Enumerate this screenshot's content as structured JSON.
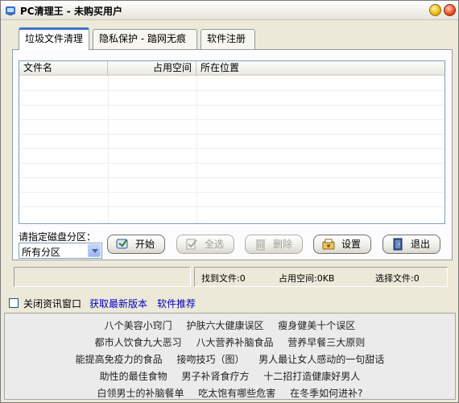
{
  "window": {
    "title": "PC清理王 - 未购买用户"
  },
  "tabs": [
    {
      "label": "垃圾文件清理"
    },
    {
      "label": "隐私保护 - 踏网无痕"
    },
    {
      "label": "软件注册"
    }
  ],
  "table": {
    "columns": [
      "文件名",
      "占用空间",
      "所在位置"
    ],
    "rows": []
  },
  "disk": {
    "label": "请指定磁盘分区：",
    "selected": "所有分区"
  },
  "buttons": {
    "start": "开始",
    "select_all": "全选",
    "delete": "删除",
    "settings": "设置",
    "exit": "退出"
  },
  "status": {
    "found_files": "找到文件:0",
    "space_used": "占用空间:0KB",
    "selected_files": "选择文件:0"
  },
  "footer": {
    "close_news_label": "关闭资讯窗口",
    "get_latest": "获取最新版本",
    "recommend": "软件推荐"
  },
  "news": [
    "八个美容小窍门 护肤六大健康误区 瘦身健美十个误区",
    "都市人饮食九大恶习 八大营养补脑食品 营养早餐三大原则",
    "能提高免疫力的食品 接吻技巧（图） 男人最让女人感动的一句甜话",
    "助性的最佳食物 男子补肾食疗方 十二招打造健康好男人",
    "白领男士的补脑餐单 吃太饱有哪些危害 在冬季如何进补?"
  ],
  "colors": {
    "accent_tab": "#3c73c8",
    "link": "#0000c0",
    "window_bg": "#ece9d8"
  }
}
